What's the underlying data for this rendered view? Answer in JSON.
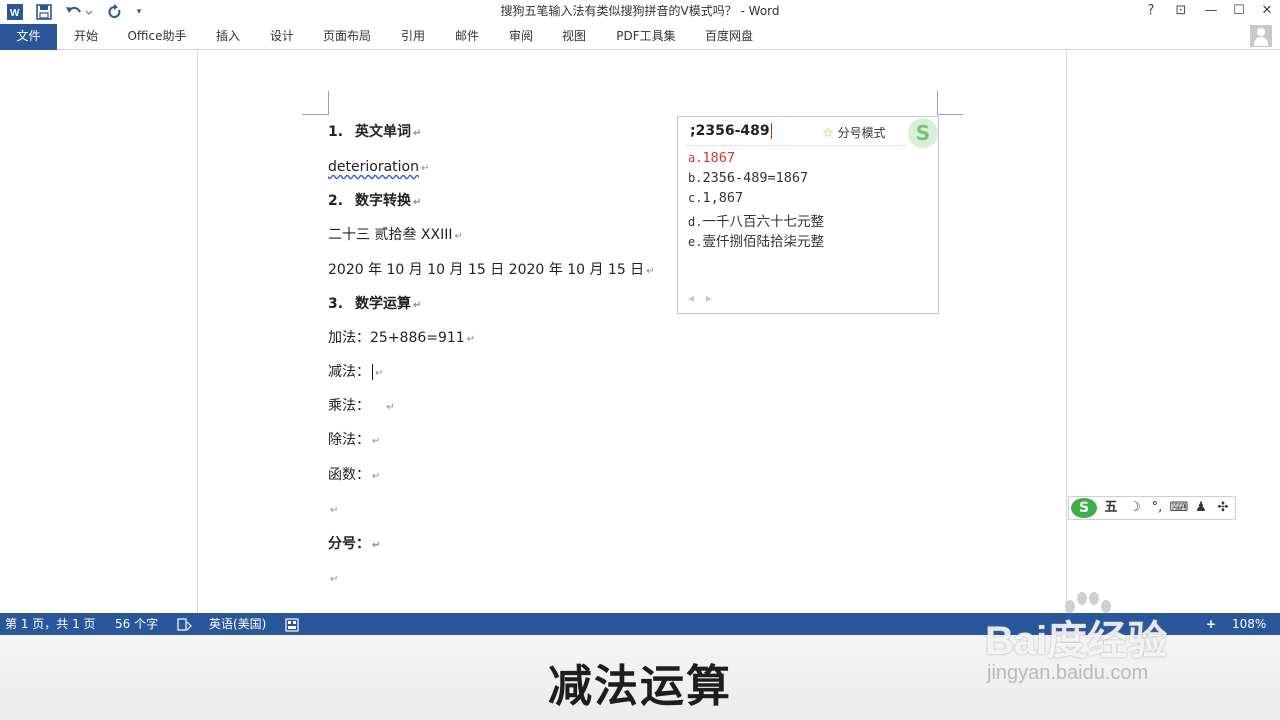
{
  "titlebar": {
    "title": "搜狗五笔输入法有类似搜狗拼音的V模式吗？ - Word",
    "help": "?",
    "ribbon_display": "⊡",
    "minimize": "—",
    "maximize": "☐",
    "close": "✕",
    "quick_access": {
      "word_icon": "W",
      "save_icon": "save-icon",
      "undo_icon": "undo-icon",
      "redo_icon": "redo-icon",
      "customize_icon": "customize-icon"
    }
  },
  "ribbon": {
    "tabs": [
      "文件",
      "开始",
      "Office助手",
      "插入",
      "设计",
      "页面布局",
      "引用",
      "邮件",
      "审阅",
      "视图",
      "PDF工具集",
      "百度网盘"
    ],
    "active_color": "#2b579a"
  },
  "document": {
    "lines": [
      {
        "num": "1.",
        "text": "英文单词"
      },
      {
        "text": "deterioration"
      },
      {
        "num": "2.",
        "text": "数字转换"
      },
      {
        "text": "二十三  贰拾叁  XXIII"
      },
      {
        "text": "2020 年 10 月  10 月 15 日  2020 年 10 月 15 日"
      },
      {
        "num": "3.",
        "text": "数学运算"
      },
      {
        "text": "加法：25+886=911"
      },
      {
        "text": "减法："
      },
      {
        "text": "乘法：  "
      },
      {
        "text": "除法："
      },
      {
        "text": "函数："
      },
      {
        "text": ""
      },
      {
        "text": "分号："
      },
      {
        "text": ""
      }
    ],
    "paragraph_mark": "↵"
  },
  "ime": {
    "input": ";2356-489",
    "mode_label": "分号模式",
    "logo": "S",
    "candidates": [
      {
        "index": "a.",
        "text": "1867"
      },
      {
        "index": "b.",
        "text": "2356-489=1867"
      },
      {
        "index": "c.",
        "text": "1,867"
      },
      {
        "index": "d.",
        "text": "一千八百六十七元整"
      },
      {
        "index": "e.",
        "text": "壹仟捌佰陆拾柒元整"
      }
    ],
    "nav": "◂ ▸"
  },
  "ime_toolbar": {
    "logo": "S",
    "mode": "五",
    "items": [
      "☽",
      "°,",
      "⌨",
      "♟",
      "✣"
    ]
  },
  "statusbar": {
    "page": "第 1 页，共 1 页",
    "words": "56 个字",
    "proof_icon": "proofing-icon",
    "language": "英语(美国)",
    "macro_icon": "macro-icon",
    "zoom_in": "+",
    "zoom": "108%"
  },
  "caption": "减法运算",
  "watermark": {
    "logo": "Bai度经验",
    "url": "jingyan.baidu.com"
  }
}
